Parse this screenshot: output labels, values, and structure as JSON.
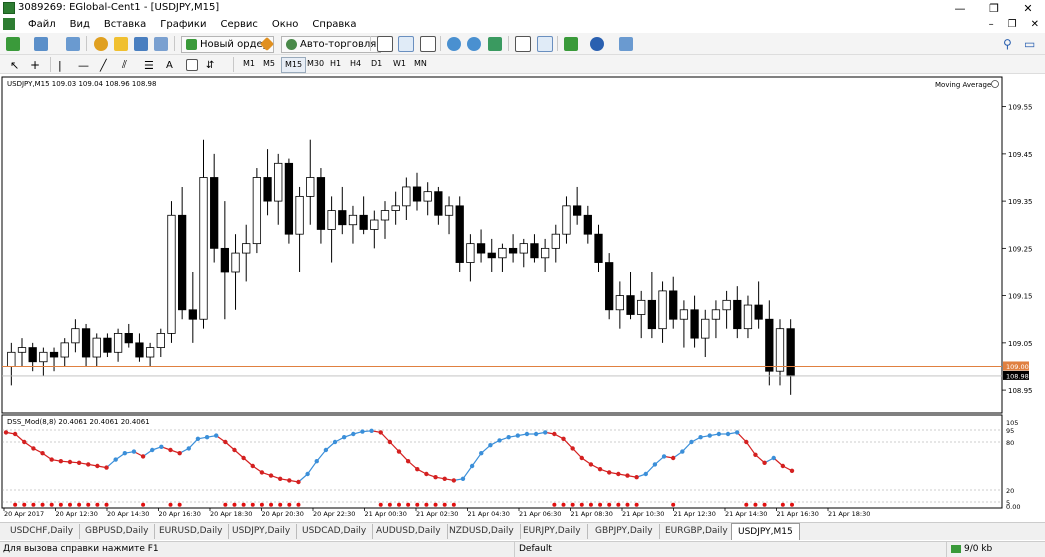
{
  "window": {
    "title": "3089269: EGlobal-Cent1 - [USDJPY,M15]",
    "min": "—",
    "max": "❐",
    "close": "✕"
  },
  "menu": {
    "items": [
      "Файл",
      "Вид",
      "Вставка",
      "Графики",
      "Сервис",
      "Окно",
      "Справка"
    ],
    "mdi_min": "–",
    "mdi_max": "❐",
    "mdi_close": "✕"
  },
  "toolbar": {
    "new_order": "Новый ордер",
    "auto_trading": "Авто-торговля"
  },
  "timeframes": [
    "M1",
    "M5",
    "M15",
    "M30",
    "H1",
    "H4",
    "D1",
    "W1",
    "MN"
  ],
  "active_timeframe": "M15",
  "chart": {
    "symbol_header": "USDJPY,M15  109.03 109.04 108.96 108.98",
    "indicator_name": "Moving Average",
    "price_ticks": [
      "109.55",
      "109.45",
      "109.35",
      "109.25",
      "109.15",
      "109.05",
      "108.95"
    ],
    "price_label_orange": "109.00",
    "price_label_current": "108.98",
    "time_ticks": [
      "20 Apr 2017",
      "20 Apr 12:30",
      "20 Apr 14:30",
      "20 Apr 16:30",
      "20 Apr 18:30",
      "20 Apr 20:30",
      "20 Apr 22:30",
      "21 Apr 00:30",
      "21 Apr 02:30",
      "21 Apr 04:30",
      "21 Apr 06:30",
      "21 Apr 08:30",
      "21 Apr 10:30",
      "21 Apr 12:30",
      "21 Apr 14:30",
      "21 Apr 16:30",
      "21 Apr 18:30"
    ],
    "subwindow_header": "DSS_Mod(8,8) 20.4061 20.4061 20.4061",
    "sub_ticks": [
      "105",
      "95",
      "80",
      "20",
      "5",
      "0.00"
    ],
    "colors": {
      "bull": "#000000",
      "bear": "#000000",
      "orange_line": "#e08040",
      "dss_up": "#3b8fd9",
      "dss_down": "#d42020",
      "signal_dot": "#e01010"
    }
  },
  "tabs": [
    "USDCHF,Daily",
    "GBPUSD,Daily",
    "EURUSD,Daily",
    "USDJPY,Daily",
    "USDCAD,Daily",
    "AUDUSD,Daily",
    "NZDUSD,Daily",
    "EURJPY,Daily",
    "GBPJPY,Daily",
    "EURGBP,Daily",
    "USDJPY,M15"
  ],
  "active_tab": "USDJPY,M15",
  "status": {
    "help": "Для вызова справки нажмите F1",
    "profile": "Default",
    "traffic": "9/0 kb"
  },
  "chart_data": {
    "type": "candlestick",
    "ylim": [
      108.91,
      109.6
    ],
    "candles": [
      [
        109.0,
        109.05,
        108.96,
        109.03
      ],
      [
        109.03,
        109.06,
        109.0,
        109.04
      ],
      [
        109.04,
        109.05,
        108.99,
        109.01
      ],
      [
        109.01,
        109.04,
        108.98,
        109.03
      ],
      [
        109.03,
        109.04,
        108.99,
        109.02
      ],
      [
        109.02,
        109.06,
        109.0,
        109.05
      ],
      [
        109.05,
        109.1,
        109.03,
        109.08
      ],
      [
        109.08,
        109.09,
        109.0,
        109.02
      ],
      [
        109.02,
        109.07,
        109.0,
        109.06
      ],
      [
        109.06,
        109.07,
        109.02,
        109.03
      ],
      [
        109.03,
        109.08,
        109.01,
        109.07
      ],
      [
        109.07,
        109.09,
        109.04,
        109.05
      ],
      [
        109.05,
        109.07,
        109.01,
        109.02
      ],
      [
        109.02,
        109.05,
        109.0,
        109.04
      ],
      [
        109.04,
        109.08,
        109.02,
        109.07
      ],
      [
        109.07,
        109.35,
        109.05,
        109.32
      ],
      [
        109.32,
        109.38,
        109.1,
        109.12
      ],
      [
        109.12,
        109.2,
        109.05,
        109.1
      ],
      [
        109.1,
        109.48,
        109.08,
        109.4
      ],
      [
        109.4,
        109.45,
        109.22,
        109.25
      ],
      [
        109.25,
        109.35,
        109.1,
        109.2
      ],
      [
        109.2,
        109.28,
        109.12,
        109.24
      ],
      [
        109.24,
        109.3,
        109.18,
        109.26
      ],
      [
        109.26,
        109.42,
        109.24,
        109.4
      ],
      [
        109.4,
        109.46,
        109.32,
        109.35
      ],
      [
        109.35,
        109.45,
        109.3,
        109.43
      ],
      [
        109.43,
        109.44,
        109.26,
        109.28
      ],
      [
        109.28,
        109.38,
        109.2,
        109.36
      ],
      [
        109.36,
        109.48,
        109.3,
        109.4
      ],
      [
        109.4,
        109.42,
        109.26,
        109.29
      ],
      [
        109.29,
        109.36,
        109.22,
        109.33
      ],
      [
        109.33,
        109.38,
        109.28,
        109.3
      ],
      [
        109.3,
        109.34,
        109.26,
        109.32
      ],
      [
        109.32,
        109.36,
        109.28,
        109.29
      ],
      [
        109.29,
        109.33,
        109.25,
        109.31
      ],
      [
        109.31,
        109.35,
        109.27,
        109.33
      ],
      [
        109.33,
        109.37,
        109.3,
        109.34
      ],
      [
        109.34,
        109.4,
        109.31,
        109.38
      ],
      [
        109.38,
        109.41,
        109.33,
        109.35
      ],
      [
        109.35,
        109.39,
        109.32,
        109.37
      ],
      [
        109.37,
        109.38,
        109.3,
        109.32
      ],
      [
        109.32,
        109.36,
        109.28,
        109.34
      ],
      [
        109.34,
        109.36,
        109.2,
        109.22
      ],
      [
        109.22,
        109.28,
        109.18,
        109.26
      ],
      [
        109.26,
        109.29,
        109.22,
        109.24
      ],
      [
        109.24,
        109.27,
        109.2,
        109.23
      ],
      [
        109.23,
        109.26,
        109.2,
        109.25
      ],
      [
        109.25,
        109.28,
        109.22,
        109.24
      ],
      [
        109.24,
        109.27,
        109.21,
        109.26
      ],
      [
        109.26,
        109.28,
        109.22,
        109.23
      ],
      [
        109.23,
        109.27,
        109.2,
        109.25
      ],
      [
        109.25,
        109.3,
        109.22,
        109.28
      ],
      [
        109.28,
        109.36,
        109.26,
        109.34
      ],
      [
        109.34,
        109.38,
        109.3,
        109.32
      ],
      [
        109.32,
        109.34,
        109.26,
        109.28
      ],
      [
        109.28,
        109.3,
        109.2,
        109.22
      ],
      [
        109.22,
        109.24,
        109.1,
        109.12
      ],
      [
        109.12,
        109.18,
        109.08,
        109.15
      ],
      [
        109.15,
        109.2,
        109.1,
        109.11
      ],
      [
        109.11,
        109.16,
        109.06,
        109.14
      ],
      [
        109.14,
        109.2,
        109.06,
        109.08
      ],
      [
        109.08,
        109.18,
        109.05,
        109.16
      ],
      [
        109.16,
        109.19,
        109.08,
        109.1
      ],
      [
        109.1,
        109.14,
        109.04,
        109.12
      ],
      [
        109.12,
        109.15,
        109.04,
        109.06
      ],
      [
        109.06,
        109.12,
        109.02,
        109.1
      ],
      [
        109.1,
        109.14,
        109.06,
        109.12
      ],
      [
        109.12,
        109.16,
        109.08,
        109.14
      ],
      [
        109.14,
        109.17,
        109.06,
        109.08
      ],
      [
        109.08,
        109.15,
        109.06,
        109.13
      ],
      [
        109.13,
        109.18,
        109.08,
        109.1
      ],
      [
        109.1,
        109.14,
        108.96,
        108.99
      ],
      [
        108.99,
        109.1,
        108.96,
        109.08
      ],
      [
        109.08,
        109.1,
        108.94,
        108.98
      ]
    ],
    "dss_values": [
      92,
      90,
      80,
      72,
      66,
      58,
      56,
      55,
      54,
      52,
      50,
      48,
      58,
      66,
      68,
      62,
      70,
      74,
      70,
      66,
      72,
      84,
      86,
      88,
      80,
      70,
      60,
      50,
      42,
      38,
      34,
      32,
      30,
      40,
      56,
      70,
      80,
      86,
      90,
      93,
      94,
      92,
      80,
      68,
      56,
      46,
      40,
      36,
      34,
      32,
      34,
      50,
      66,
      76,
      82,
      86,
      88,
      90,
      90,
      92,
      90,
      84,
      72,
      60,
      52,
      46,
      42,
      40,
      38,
      36,
      40,
      52,
      62,
      60,
      68,
      80,
      86,
      88,
      90,
      90,
      92,
      80,
      64,
      54,
      60,
      50,
      44
    ]
  }
}
